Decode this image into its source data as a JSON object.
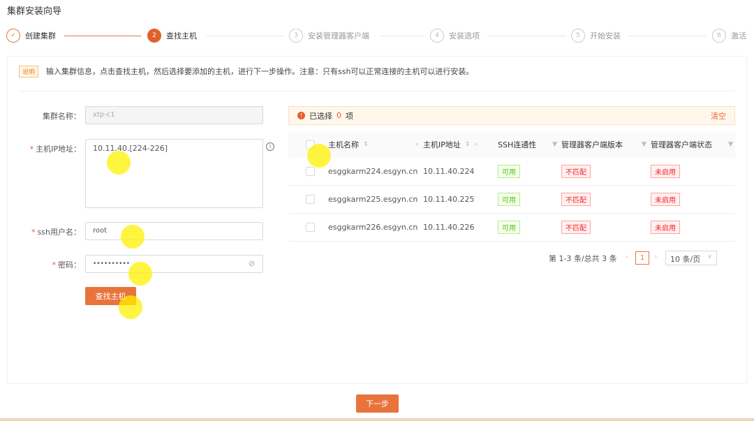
{
  "title": "集群安装向导",
  "steps": [
    {
      "num": "✓",
      "label": "创建集群",
      "state": "done"
    },
    {
      "num": "2",
      "label": "查找主机",
      "state": "active"
    },
    {
      "num": "3",
      "label": "安装管理器客户端",
      "state": "pending"
    },
    {
      "num": "4",
      "label": "安装选项",
      "state": "pending"
    },
    {
      "num": "5",
      "label": "开始安装",
      "state": "pending"
    },
    {
      "num": "6",
      "label": "激活",
      "state": "pending"
    }
  ],
  "notice": {
    "badge": "说明",
    "text": "输入集群信息，点击查找主机，然后选择要添加的主机，进行下一步操作。注意：只有ssh可以正常连接的主机可以进行安装。"
  },
  "form": {
    "cluster_name_label": "集群名称：",
    "cluster_name_value": "xtp-c1",
    "ip_label": "主机IP地址：",
    "ip_value": "10.11.40.[224-226]",
    "user_label": "ssh用户名：",
    "user_value": "root",
    "password_label": "密码：",
    "password_value": "••••••••••",
    "required_mark": "*",
    "find_button": "查找主机"
  },
  "selection": {
    "prefix": "已选择",
    "count": "0",
    "suffix": "项",
    "clear": "清空"
  },
  "table": {
    "headers": [
      "主机名称",
      "主机IP地址",
      "SSH连通性",
      "管理器客户端版本",
      "管理器客户端状态"
    ],
    "rows": [
      {
        "host": "esggkarm224.esgyn.cn",
        "ip": "10.11.40.224",
        "ssh": "可用",
        "version": "不匹配",
        "status": "未启用"
      },
      {
        "host": "esggkarm225.esgyn.cn",
        "ip": "10.11.40.225",
        "ssh": "可用",
        "version": "不匹配",
        "status": "未启用"
      },
      {
        "host": "esggkarm226.esgyn.cn",
        "ip": "10.11.40.226",
        "ssh": "可用",
        "version": "不匹配",
        "status": "未启用"
      }
    ]
  },
  "pagination": {
    "summary": "第 1-3 条/总共 3 条",
    "current": "1",
    "page_size": "10 条/页"
  },
  "next_button": "下一步",
  "colors": {
    "accent": "#e8743b",
    "success": "#52c41a",
    "danger": "#f5222d"
  }
}
